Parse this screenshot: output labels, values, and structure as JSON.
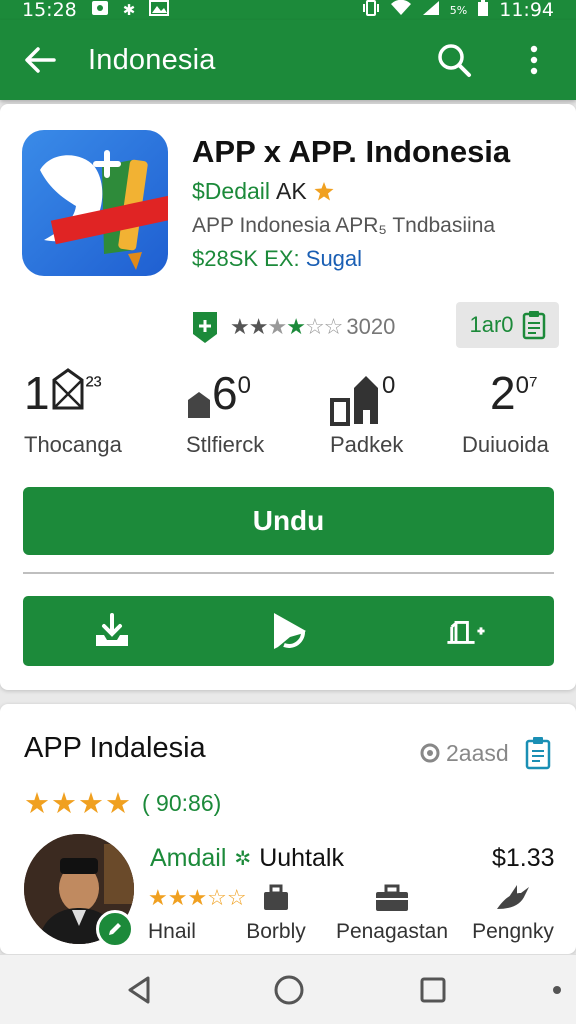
{
  "status_bar": {
    "time_left": "15:28",
    "battery": "5%",
    "time_right": "11:94"
  },
  "app_bar": {
    "title": "Indonesia"
  },
  "app": {
    "name": "APP x APP. Indonesia",
    "developer": "$Dedail",
    "developer_suffix": "AK",
    "subtitle": "APP Indonesia APR₅ Tndbasiina",
    "price_green": "$28SK EX:",
    "price_blue": "Sugal",
    "rating_count": "3020",
    "badge_text": "1ar0"
  },
  "stats": [
    {
      "value": "1",
      "sup": "²³",
      "label": "Thocanga"
    },
    {
      "value": "6",
      "sup": "0",
      "label": "Stlfierck"
    },
    {
      "value": "",
      "sup": "0",
      "label": "Padkek"
    },
    {
      "value": "2",
      "sup": "0⁷",
      "label": "Duiuoida"
    }
  ],
  "install_button": "Undu",
  "review_section": {
    "title": "APP Indalesia",
    "meta": "2aasd",
    "rating_text": "( 90:86)",
    "reviewer_name": "Amdail",
    "reviewer_tag": "Uuhtalk",
    "price": "$1.33",
    "categories": [
      "Hnail",
      "Borbly",
      "Penagastan",
      "Pengnky"
    ]
  },
  "colors": {
    "primary_green": "#1c8a3a",
    "star_orange": "#f0a020",
    "link_blue": "#1a5fb4"
  },
  "icons": {
    "back": "arrow-left-icon",
    "search": "search-icon",
    "more": "more-vert-icon",
    "download": "download-icon",
    "play": "play-icon",
    "add_device": "add-device-icon"
  }
}
